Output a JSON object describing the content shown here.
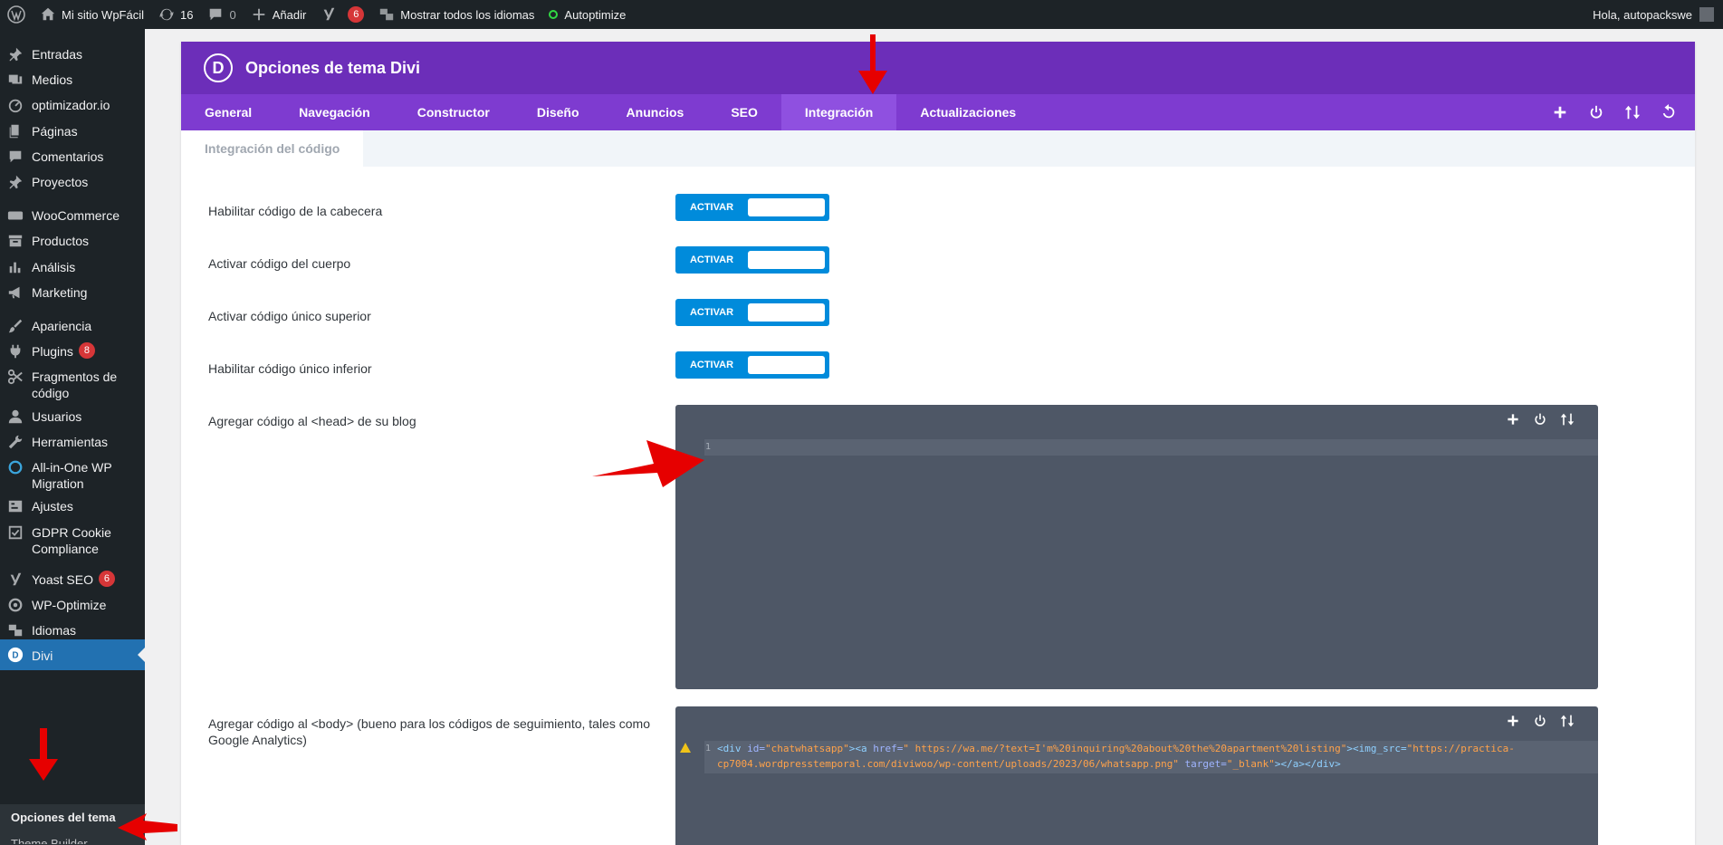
{
  "adminbar": {
    "site_name": "Mi sitio WpFácil",
    "updates_count": "16",
    "comments_count": "0",
    "add_label": "Añadir",
    "yoast_count": "6",
    "languages_label": "Mostrar todos los idiomas",
    "autoptimize_label": "Autoptimize",
    "greeting": "Hola, autopackswe"
  },
  "sidebar": {
    "items": [
      {
        "label": "Entradas",
        "icon": "pin-icon"
      },
      {
        "label": "Medios",
        "icon": "media-icon"
      },
      {
        "label": "optimizador.io",
        "icon": "gauge-icon"
      },
      {
        "label": "Páginas",
        "icon": "pages-icon"
      },
      {
        "label": "Comentarios",
        "icon": "comment-icon"
      },
      {
        "label": "Proyectos",
        "icon": "pin-icon"
      },
      {
        "label": "WooCommerce",
        "icon": "woo-icon"
      },
      {
        "label": "Productos",
        "icon": "archive-icon"
      },
      {
        "label": "Análisis",
        "icon": "chart-icon"
      },
      {
        "label": "Marketing",
        "icon": "megaphone-icon"
      },
      {
        "label": "Apariencia",
        "icon": "brush-icon"
      },
      {
        "label": "Plugins",
        "icon": "plug-icon",
        "badge": "8"
      },
      {
        "label": "Fragmentos de código",
        "icon": "scissors-icon"
      },
      {
        "label": "Usuarios",
        "icon": "user-icon"
      },
      {
        "label": "Herramientas",
        "icon": "wrench-icon"
      },
      {
        "label": "All-in-One WP Migration",
        "icon": "migration-icon"
      },
      {
        "label": "Ajustes",
        "icon": "settings-icon"
      },
      {
        "label": "GDPR Cookie Compliance",
        "icon": "check-icon"
      },
      {
        "label": "Yoast SEO",
        "icon": "yoast-icon",
        "badge": "6"
      },
      {
        "label": "WP-Optimize",
        "icon": "optimize-icon"
      },
      {
        "label": "Idiomas",
        "icon": "translate-icon"
      },
      {
        "label": "Divi",
        "icon": "divi-icon"
      }
    ],
    "submenu_active": "Opciones del tema",
    "submenu_next": "Theme Builder"
  },
  "panel": {
    "logo_letter": "D",
    "title": "Opciones de tema Divi",
    "tabs": [
      "General",
      "Navegación",
      "Constructor",
      "Diseño",
      "Anuncios",
      "SEO",
      "Integración",
      "Actualizaciones"
    ],
    "active_tab": "Integración",
    "subtab": "Integración del código",
    "options": [
      {
        "label": "Habilitar código de la cabecera",
        "toggle": "ACTIVAR"
      },
      {
        "label": "Activar código del cuerpo",
        "toggle": "ACTIVAR"
      },
      {
        "label": "Activar código único superior",
        "toggle": "ACTIVAR"
      },
      {
        "label": "Habilitar código único inferior",
        "toggle": "ACTIVAR"
      }
    ],
    "head_label": "Agregar código al <head> de su blog",
    "head_line_number": "1",
    "body_label": "Agregar código al <body> (bueno para los códigos de seguimiento, tales como Google Analytics)",
    "body_line_number": "1",
    "body_code": {
      "p1": "<div ",
      "p2": "id=",
      "p3": "\"chatwhatsapp\"",
      "p4": "><a ",
      "p5": "href=",
      "p6": "\" https://wa.me/?text=I'm%20inquiring%20about%20the%20apartment%20listing\"",
      "p7": "><img_src=",
      "p8": "\"https://practica-cp7004.wordpresstemporal.com/diviwoo/wp-content/uploads/2023/06/whatsapp.png\"",
      "p9": " target=",
      "p10": "\"_blank\"",
      "p11": "></a></div>"
    }
  },
  "colors": {
    "adminbar_bg": "#1d2327",
    "divi_purple": "#6c2eb9",
    "tab_purple": "#7e3bd0",
    "toggle_blue": "#008bdb",
    "editor_bg": "#4e5766",
    "active_menu": "#2271b1",
    "annotation_red": "#e60000"
  }
}
